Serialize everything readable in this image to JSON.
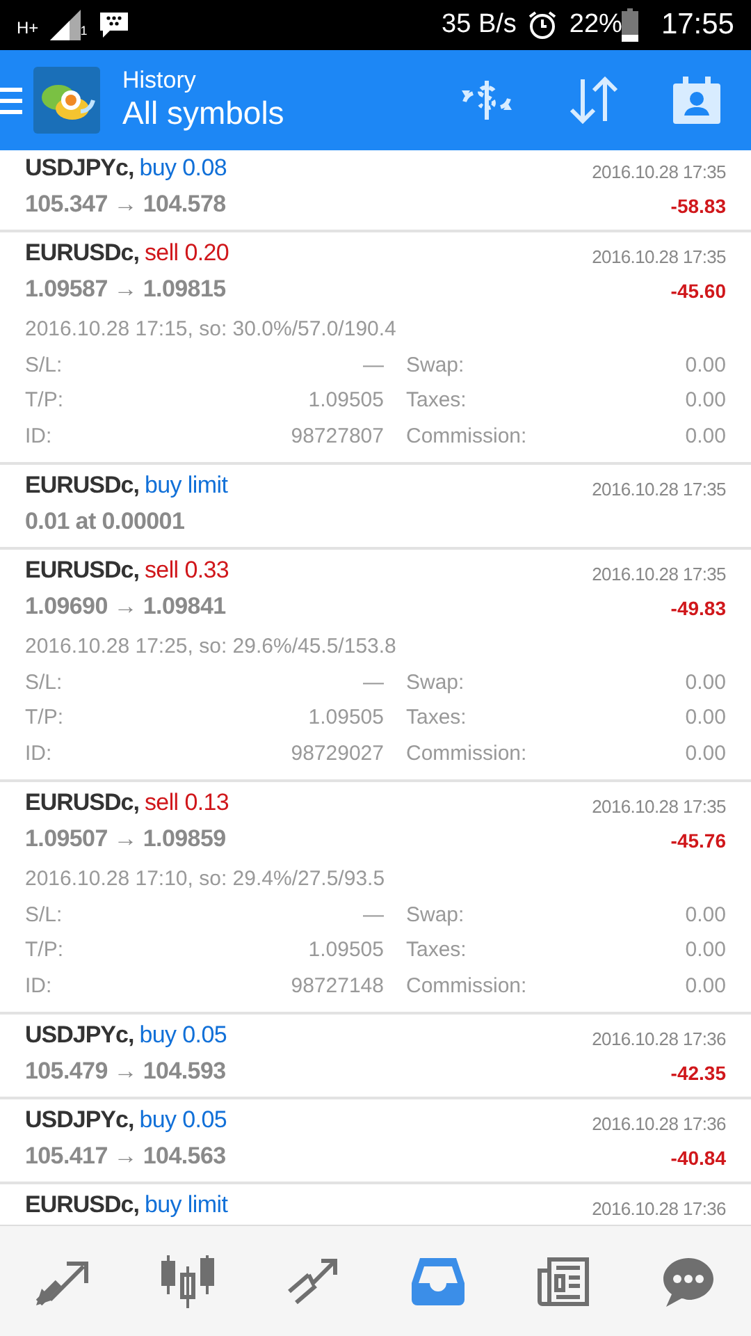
{
  "status_bar": {
    "network": "H+",
    "sim": "1",
    "speed": "35 B/s",
    "battery": "22%",
    "time": "17:55"
  },
  "app_bar": {
    "title": "History",
    "subtitle": "All symbols"
  },
  "trades": [
    {
      "symbol": "USDJPYc,",
      "kind": "buy",
      "action": "buy 0.08",
      "prices": "105.347 → 104.578",
      "time": "2016.10.28 17:35",
      "profit": "-58.83"
    },
    {
      "symbol": "EURUSDc,",
      "kind": "sell",
      "action": "sell 0.20",
      "prices": "1.09587 → 1.09815",
      "time": "2016.10.28 17:35",
      "profit": "-45.60",
      "info": "2016.10.28 17:15, so: 30.0%/57.0/190.4",
      "details": [
        {
          "label": "S/L:",
          "value": "—",
          "label2": "Swap:",
          "value2": "0.00"
        },
        {
          "label": "T/P:",
          "value": "1.09505",
          "label2": "Taxes:",
          "value2": "0.00"
        },
        {
          "label": "ID:",
          "value": "98727807",
          "label2": "Commission:",
          "value2": "0.00"
        }
      ]
    },
    {
      "symbol": "EURUSDc,",
      "kind": "buy",
      "action": "buy limit",
      "prices": "0.01 at 0.00001",
      "time": "2016.10.28 17:35"
    },
    {
      "symbol": "EURUSDc,",
      "kind": "sell",
      "action": "sell 0.33",
      "prices": "1.09690 → 1.09841",
      "time": "2016.10.28 17:35",
      "profit": "-49.83",
      "info": "2016.10.28 17:25, so: 29.6%/45.5/153.8",
      "details": [
        {
          "label": "S/L:",
          "value": "—",
          "label2": "Swap:",
          "value2": "0.00"
        },
        {
          "label": "T/P:",
          "value": "1.09505",
          "label2": "Taxes:",
          "value2": "0.00"
        },
        {
          "label": "ID:",
          "value": "98729027",
          "label2": "Commission:",
          "value2": "0.00"
        }
      ]
    },
    {
      "symbol": "EURUSDc,",
      "kind": "sell",
      "action": "sell 0.13",
      "prices": "1.09507 → 1.09859",
      "time": "2016.10.28 17:35",
      "profit": "-45.76",
      "info": "2016.10.28 17:10, so: 29.4%/27.5/93.5",
      "details": [
        {
          "label": "S/L:",
          "value": "—",
          "label2": "Swap:",
          "value2": "0.00"
        },
        {
          "label": "T/P:",
          "value": "1.09505",
          "label2": "Taxes:",
          "value2": "0.00"
        },
        {
          "label": "ID:",
          "value": "98727148",
          "label2": "Commission:",
          "value2": "0.00"
        }
      ]
    },
    {
      "symbol": "USDJPYc,",
      "kind": "buy",
      "action": "buy 0.05",
      "prices": "105.479 → 104.593",
      "time": "2016.10.28 17:36",
      "profit": "-42.35"
    },
    {
      "symbol": "USDJPYc,",
      "kind": "buy",
      "action": "buy 0.05",
      "prices": "105.417 → 104.563",
      "time": "2016.10.28 17:36",
      "profit": "-40.84"
    },
    {
      "symbol": "EURUSDc,",
      "kind": "buy",
      "action": "buy limit",
      "time": "2016.10.28 17:36"
    }
  ],
  "bottom_nav": [
    {
      "kind": "quotes",
      "selected": false
    },
    {
      "kind": "chart",
      "selected": false
    },
    {
      "kind": "trade",
      "selected": false
    },
    {
      "kind": "history",
      "selected": true
    },
    {
      "kind": "news",
      "selected": false
    },
    {
      "kind": "chat",
      "selected": false
    }
  ]
}
